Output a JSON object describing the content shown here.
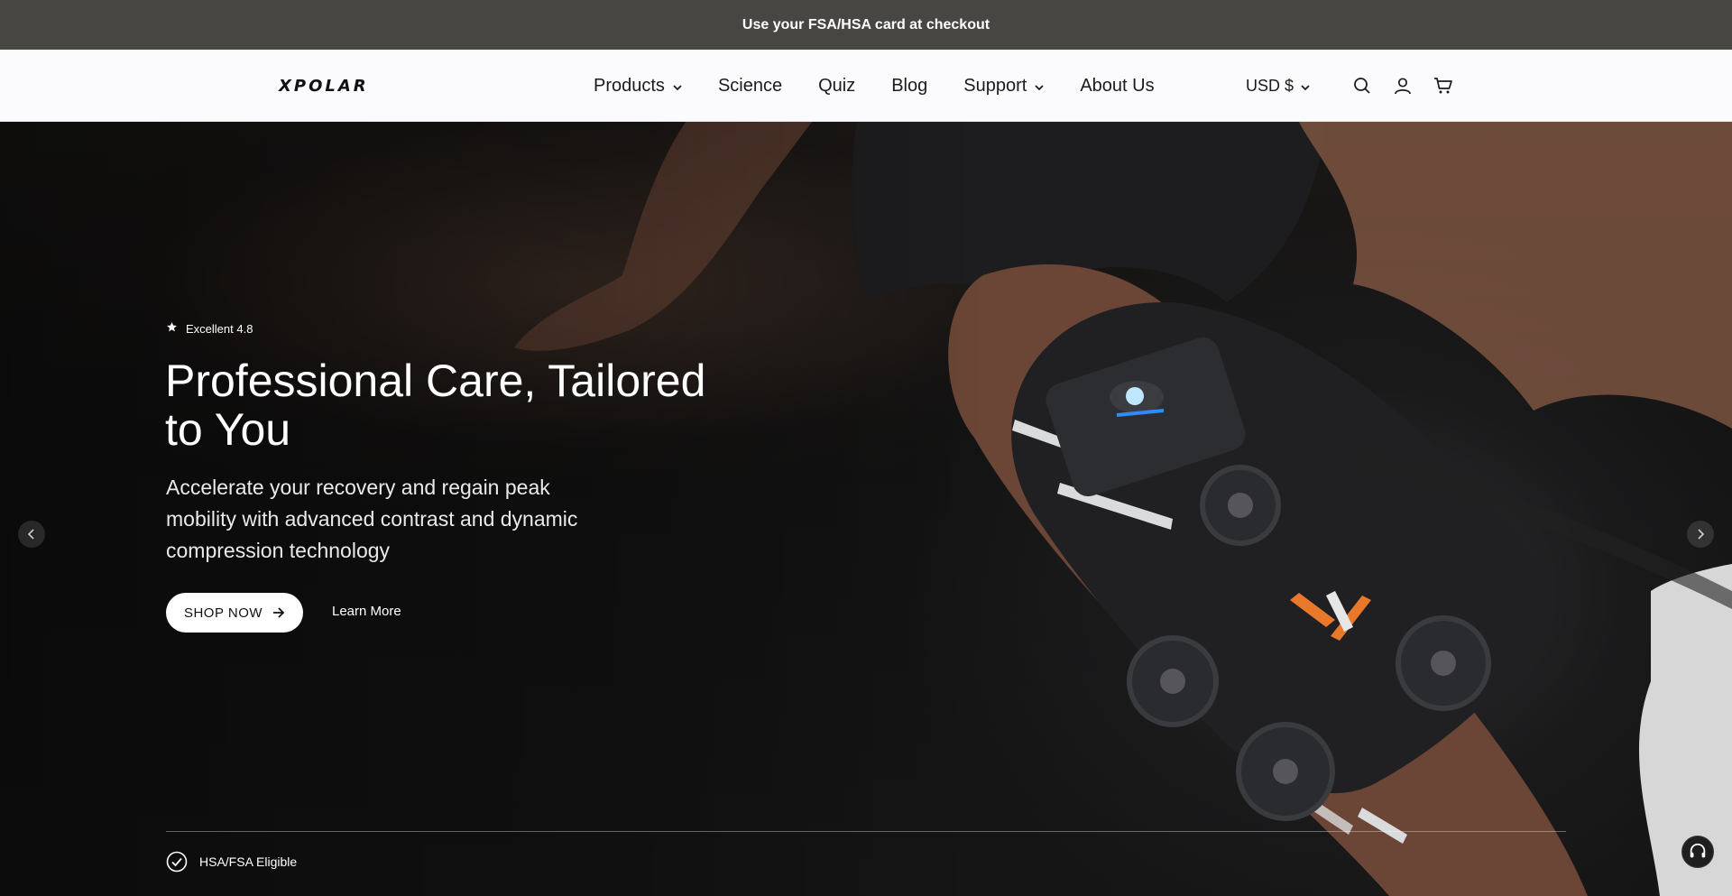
{
  "announcement": {
    "text": "Use your FSA/HSA card at checkout"
  },
  "header": {
    "logo": "XPOLAR",
    "nav": [
      {
        "label": "Products",
        "has_dropdown": true
      },
      {
        "label": "Science",
        "has_dropdown": false
      },
      {
        "label": "Quiz",
        "has_dropdown": false
      },
      {
        "label": "Blog",
        "has_dropdown": false
      },
      {
        "label": "Support",
        "has_dropdown": true
      },
      {
        "label": "About Us",
        "has_dropdown": false
      }
    ],
    "currency": "USD $",
    "icons": [
      "search-icon",
      "account-icon",
      "cart-icon"
    ]
  },
  "hero": {
    "rating": "Excellent 4.8",
    "title": "Professional Care, Tailored to You",
    "subtitle": "Accelerate your recovery and regain peak mobility with advanced contrast and dynamic compression technology",
    "cta_primary": "SHOP NOW",
    "cta_secondary": "Learn More",
    "badge": "HSA/FSA Eligible",
    "product_brand": "XPOLAR"
  },
  "colors": {
    "announcement_bg": "#474643",
    "header_bg": "#fbfbfd",
    "accent_orange": "#e8782a",
    "text_dark": "#1b1b1b"
  }
}
